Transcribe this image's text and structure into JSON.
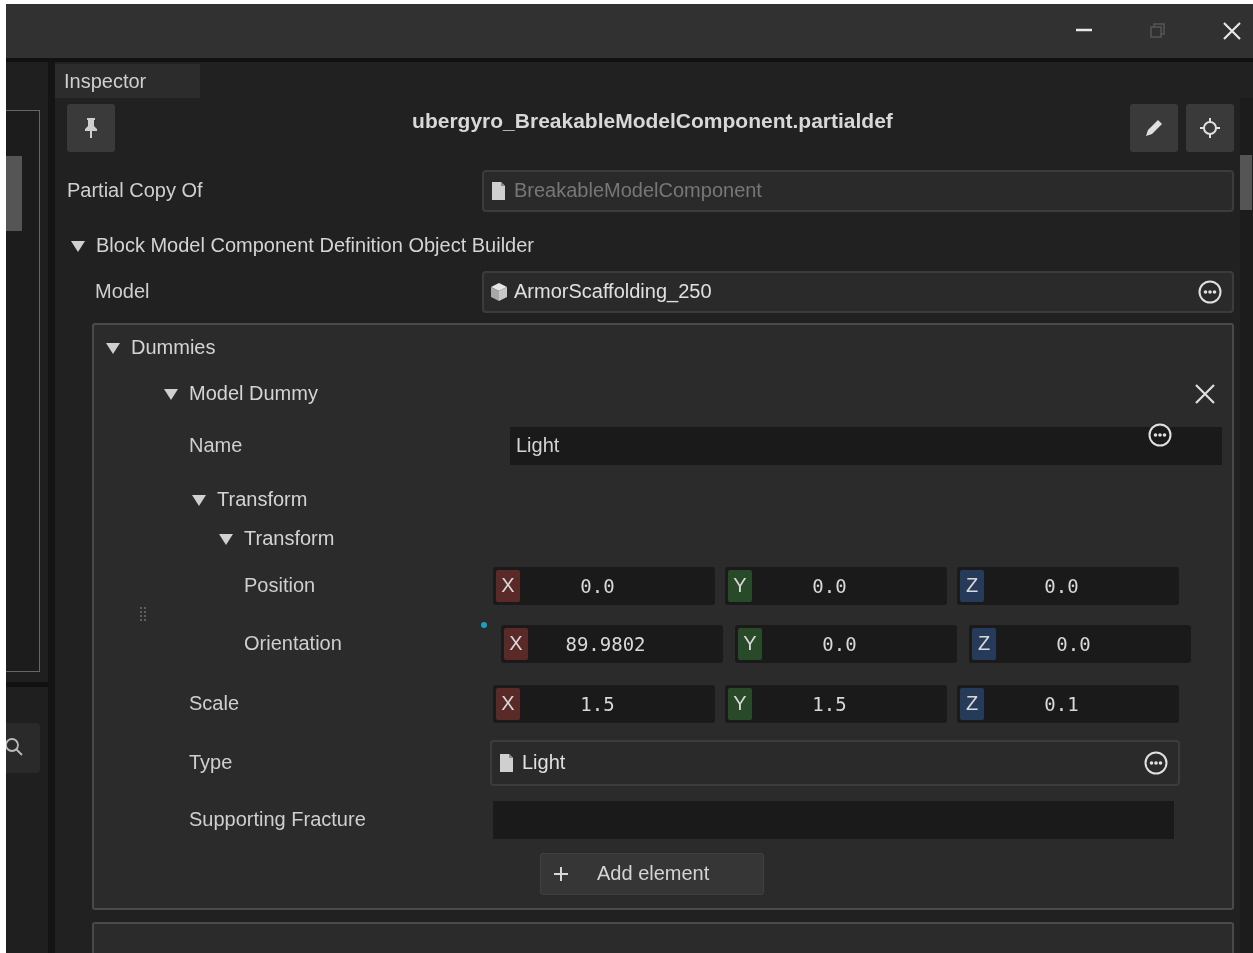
{
  "window": {
    "controls": [
      {
        "kind": "minimize",
        "disabled": false
      },
      {
        "kind": "restore",
        "disabled": true
      },
      {
        "kind": "close",
        "disabled": false
      }
    ]
  },
  "tab": {
    "label": "Inspector"
  },
  "title": "ubergyro_BreakableModelComponent.partialdef",
  "partial_copy_of": {
    "label": "Partial Copy Of",
    "value": "BreakableModelComponent",
    "disabled": true
  },
  "builder": {
    "label": "Block Model Component Definition Object Builder",
    "expanded": true,
    "model": {
      "label": "Model",
      "value": "ArmorScaffolding_250"
    },
    "dummies": {
      "label": "Dummies",
      "expanded": true,
      "items": [
        {
          "label": "Model Dummy",
          "expanded": true,
          "name": {
            "label": "Name",
            "value": "Light"
          },
          "transform": {
            "label": "Transform",
            "expanded": true,
            "inner": {
              "label": "Transform",
              "expanded": true,
              "rows": [
                {
                  "label": "Position",
                  "modified": false,
                  "components": [
                    {
                      "axis": "X",
                      "color": "#5a2a28",
                      "value": "0.0"
                    },
                    {
                      "axis": "Y",
                      "color": "#284a28",
                      "value": "0.0"
                    },
                    {
                      "axis": "Z",
                      "color": "#263a5a",
                      "value": "0.0"
                    }
                  ]
                },
                {
                  "label": "Orientation",
                  "modified": true,
                  "components": [
                    {
                      "axis": "X",
                      "color": "#5a2a28",
                      "value": "89.9802"
                    },
                    {
                      "axis": "Y",
                      "color": "#284a28",
                      "value": "0.0"
                    },
                    {
                      "axis": "Z",
                      "color": "#263a5a",
                      "value": "0.0"
                    }
                  ]
                }
              ]
            }
          },
          "scale": {
            "label": "Scale",
            "components": [
              {
                "axis": "X",
                "color": "#5a2a28",
                "value": "1.5"
              },
              {
                "axis": "Y",
                "color": "#284a28",
                "value": "1.5"
              },
              {
                "axis": "Z",
                "color": "#263a5a",
                "value": "0.1"
              }
            ]
          },
          "type": {
            "label": "Type",
            "value": "Light"
          },
          "supporting_fracture": {
            "label": "Supporting Fracture"
          }
        }
      ],
      "add_button": "Add element"
    }
  }
}
